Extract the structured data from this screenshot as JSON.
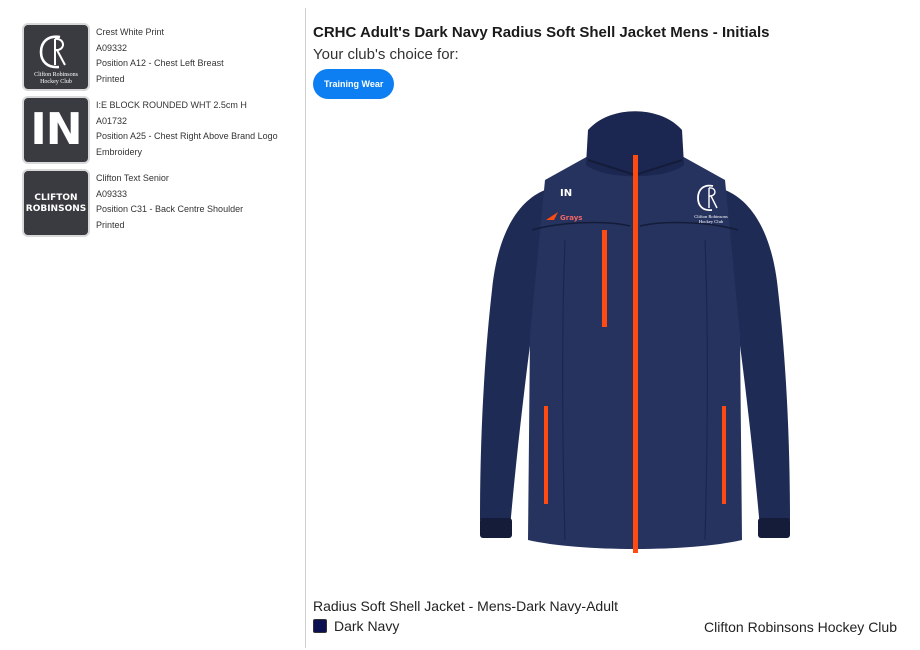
{
  "logos": [
    {
      "name": "Crest White Print",
      "code": "A09332",
      "position": "Position A12 - Chest Left Breast",
      "method": "Printed",
      "tile_text_line1": "Clifton Robinsons",
      "tile_text_line2": "Hockey Club"
    },
    {
      "name": "I:E BLOCK ROUNDED WHT 2.5cm H",
      "code": "A01732",
      "position": "Position A25 - Chest Right Above Brand Logo",
      "method": "Embroidery",
      "tile_text": "IN"
    },
    {
      "name": "Clifton Text Senior",
      "code": "A09333",
      "position": "Position C31 - Back Centre Shoulder",
      "method": "Printed",
      "tile_text_line1": "CLIFTON",
      "tile_text_line2": "ROBINSONS"
    }
  ],
  "product": {
    "title": "CRHC Adult's Dark Navy Radius Soft Shell Jacket Mens - Initials",
    "choice_label": "Your club's choice for:",
    "category_tag": "Training Wear",
    "jacket_initials": "IN",
    "jacket_brand": "Grays",
    "jacket_crest_line1": "Clifton Robinsons",
    "jacket_crest_line2": "Hockey Club",
    "variant": "Radius Soft Shell Jacket - Mens-Dark Navy-Adult",
    "colour_name": "Dark Navy",
    "colour_hex": "#0c1050",
    "club": "Clifton Robinsons Hockey Club"
  }
}
